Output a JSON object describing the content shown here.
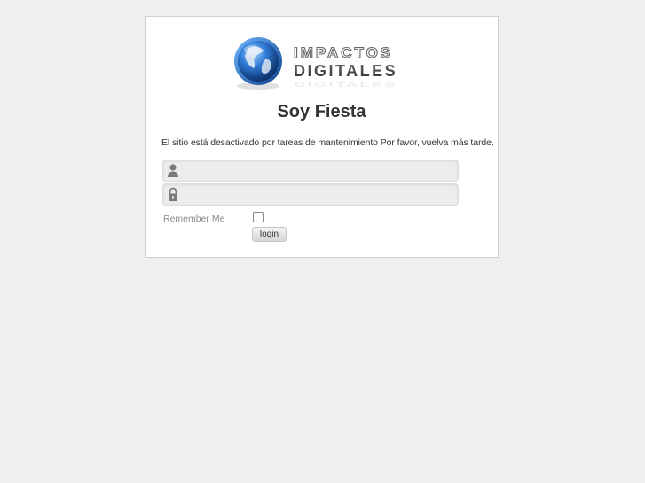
{
  "brand": {
    "logo_line1": "IMPACTOS",
    "logo_line2": "DIGITALES",
    "globe_color": "#1f5fb8",
    "logo_text_color": "#555555"
  },
  "site": {
    "title": "Soy Fiesta",
    "offline_message": "El sitio está desactivado por tareas de mantenimiento Por favor, vuelva más tarde."
  },
  "form": {
    "username_value": "",
    "password_value": "",
    "remember_label": "Remember Me",
    "remember_checked": false,
    "login_label": "login",
    "user_icon": "user-icon",
    "password_icon": "lock-icon"
  }
}
